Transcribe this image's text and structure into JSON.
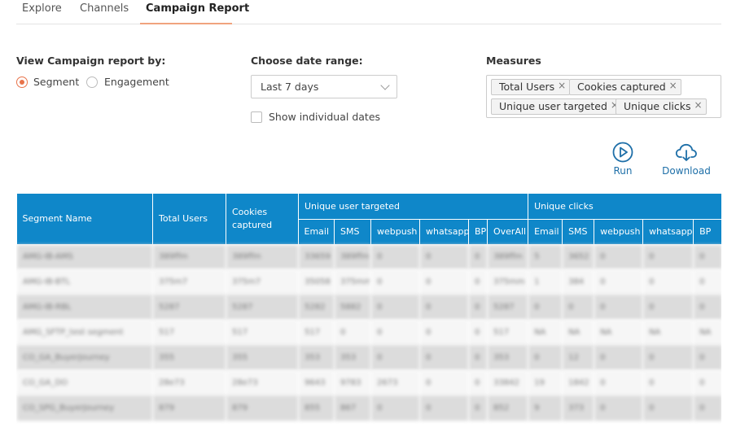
{
  "tabs": [
    {
      "label": "Explore",
      "active": false
    },
    {
      "label": "Channels",
      "active": false
    },
    {
      "label": "Campaign Report",
      "active": true
    }
  ],
  "view_by": {
    "label": "View Campaign report by:",
    "options": [
      "Segment",
      "Engagement"
    ],
    "selected": "Segment"
  },
  "date_range": {
    "label": "Choose date range:",
    "value": "Last 7 days",
    "show_individual_dates": "Show individual dates",
    "checked": false
  },
  "measures": {
    "label": "Measures",
    "chips": [
      "Total Users",
      "Cookies captured",
      "Unique user targeted",
      "Unique clicks"
    ]
  },
  "actions": {
    "run": "Run",
    "download": "Download"
  },
  "colors": {
    "accent": "#e8734a",
    "header": "#0f87c9",
    "link": "#1e6fa8"
  },
  "table": {
    "headers": {
      "segment_name": "Segment Name",
      "total_users": "Total Users",
      "cookies_captured": "Cookies captured",
      "unique_user_targeted": "Unique user targeted",
      "unique_clicks": "Unique clicks"
    },
    "sub_headers_targeted": [
      "Email",
      "SMS",
      "webpush",
      "whatsapp",
      "BP",
      "OverAll"
    ],
    "sub_headers_clicks": [
      "Email",
      "SMS",
      "webpush",
      "whatsapp",
      "BP"
    ],
    "rows": [
      [
        "AMG-IB-AMS",
        "389ffm",
        "389ffm",
        "33659",
        "389ffm",
        "0",
        "0",
        "0",
        "389ffm",
        "5",
        "3652",
        "0",
        "0",
        "0"
      ],
      [
        "AMG-IB-BTL",
        "375m7",
        "375m7",
        "35058",
        "375mm",
        "0",
        "0",
        "0",
        "375mm",
        "1",
        "384",
        "0",
        "0",
        "0"
      ],
      [
        "AMG-IB-RBL",
        "5287",
        "5287",
        "5282",
        "5882",
        "0",
        "0",
        "0",
        "5287",
        "0",
        "0",
        "0",
        "0",
        "0"
      ],
      [
        "AMG_SFTP_test segment",
        "517",
        "517",
        "517",
        "0",
        "0",
        "0",
        "0",
        "517",
        "NA",
        "NA",
        "NA",
        "NA",
        "NA"
      ],
      [
        "CO_GA_BuyerJourney",
        "355",
        "355",
        "353",
        "353",
        "0",
        "0",
        "0",
        "353",
        "0",
        "12",
        "0",
        "0",
        "0"
      ],
      [
        "CO_GA_DO",
        "28e73",
        "28e73",
        "9643",
        "9783",
        "2673",
        "0",
        "0",
        "33842",
        "19",
        "1842",
        "0",
        "0",
        "0"
      ],
      [
        "CO_SPG_BuyerJourney",
        "879",
        "879",
        "855",
        "867",
        "0",
        "0",
        "0",
        "852",
        "9",
        "373",
        "0",
        "0",
        "0"
      ]
    ]
  }
}
